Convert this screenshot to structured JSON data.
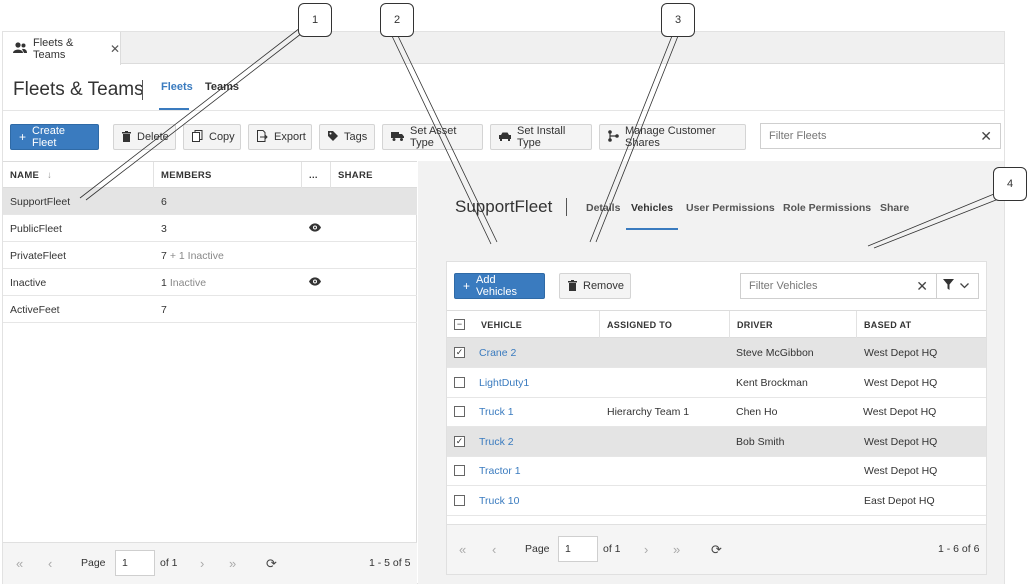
{
  "doc_tab": {
    "label": "Fleets & Teams"
  },
  "header": {
    "title": "Fleets & Teams",
    "tabs": [
      {
        "label": "Fleets"
      },
      {
        "label": "Teams"
      }
    ]
  },
  "toolbar": {
    "create": "Create Fleet",
    "delete": "Delete",
    "copy": "Copy",
    "export": "Export",
    "tags": "Tags",
    "set_asset_type": "Set Asset Type",
    "set_install_type": "Set Install Type",
    "manage_shares": "Manage Customer Shares",
    "filter_placeholder": "Filter Fleets"
  },
  "fleets_grid": {
    "columns": {
      "name": "NAME",
      "members": "MEMBERS",
      "more": "...",
      "share": "SHARE"
    },
    "rows": [
      {
        "name": "SupportFleet",
        "members": "6",
        "inactive": "",
        "shared": false
      },
      {
        "name": "PublicFleet",
        "members": "3",
        "inactive": "",
        "shared": true
      },
      {
        "name": "PrivateFleet",
        "members": "7",
        "inactive": "+ 1 Inactive",
        "shared": false
      },
      {
        "name": "Inactive",
        "members": "1",
        "inactive": "Inactive",
        "shared": true
      },
      {
        "name": "ActiveFeet",
        "members": "7",
        "inactive": "",
        "shared": false
      }
    ],
    "pager": {
      "page_label": "Page",
      "page": "1",
      "of": "of 1",
      "summary": "1 - 5 of 5"
    }
  },
  "detail": {
    "title": "SupportFleet",
    "tabs": [
      {
        "label": "Details"
      },
      {
        "label": "Vehicles"
      },
      {
        "label": "User Permissions"
      },
      {
        "label": "Role Permissions"
      },
      {
        "label": "Share"
      }
    ],
    "add_vehicles": "Add Vehicles",
    "remove": "Remove",
    "filter_placeholder": "Filter Vehicles",
    "columns": {
      "vehicle": "VEHICLE",
      "assigned": "ASSIGNED TO",
      "driver": "DRIVER",
      "based": "BASED AT"
    },
    "rows": [
      {
        "vehicle": "Crane 2",
        "assigned": "",
        "driver": "Steve McGibbon",
        "based": "West Depot HQ",
        "checked": true
      },
      {
        "vehicle": "LightDuty1",
        "assigned": "",
        "driver": "Kent Brockman",
        "based": "West Depot HQ",
        "checked": false
      },
      {
        "vehicle": "Truck 1",
        "assigned": "Hierarchy Team 1",
        "driver": "Chen Ho",
        "based": "West Depot HQ",
        "checked": false
      },
      {
        "vehicle": "Truck 2",
        "assigned": "",
        "driver": "Bob Smith",
        "based": "West Depot HQ",
        "checked": true
      },
      {
        "vehicle": "Tractor 1",
        "assigned": "",
        "driver": "",
        "based": "West Depot HQ",
        "checked": false
      },
      {
        "vehicle": "Truck 10",
        "assigned": "",
        "driver": "",
        "based": "East Depot HQ",
        "checked": false
      }
    ],
    "pager": {
      "page_label": "Page",
      "page": "1",
      "of": "of 1",
      "summary": "1 - 6 of 6"
    }
  },
  "callouts": [
    "1",
    "2",
    "3",
    "4"
  ],
  "colors": {
    "accent": "#3a7bbf",
    "selected_row": "#e4e4e4",
    "panel_bg": "#f2f2f2"
  }
}
